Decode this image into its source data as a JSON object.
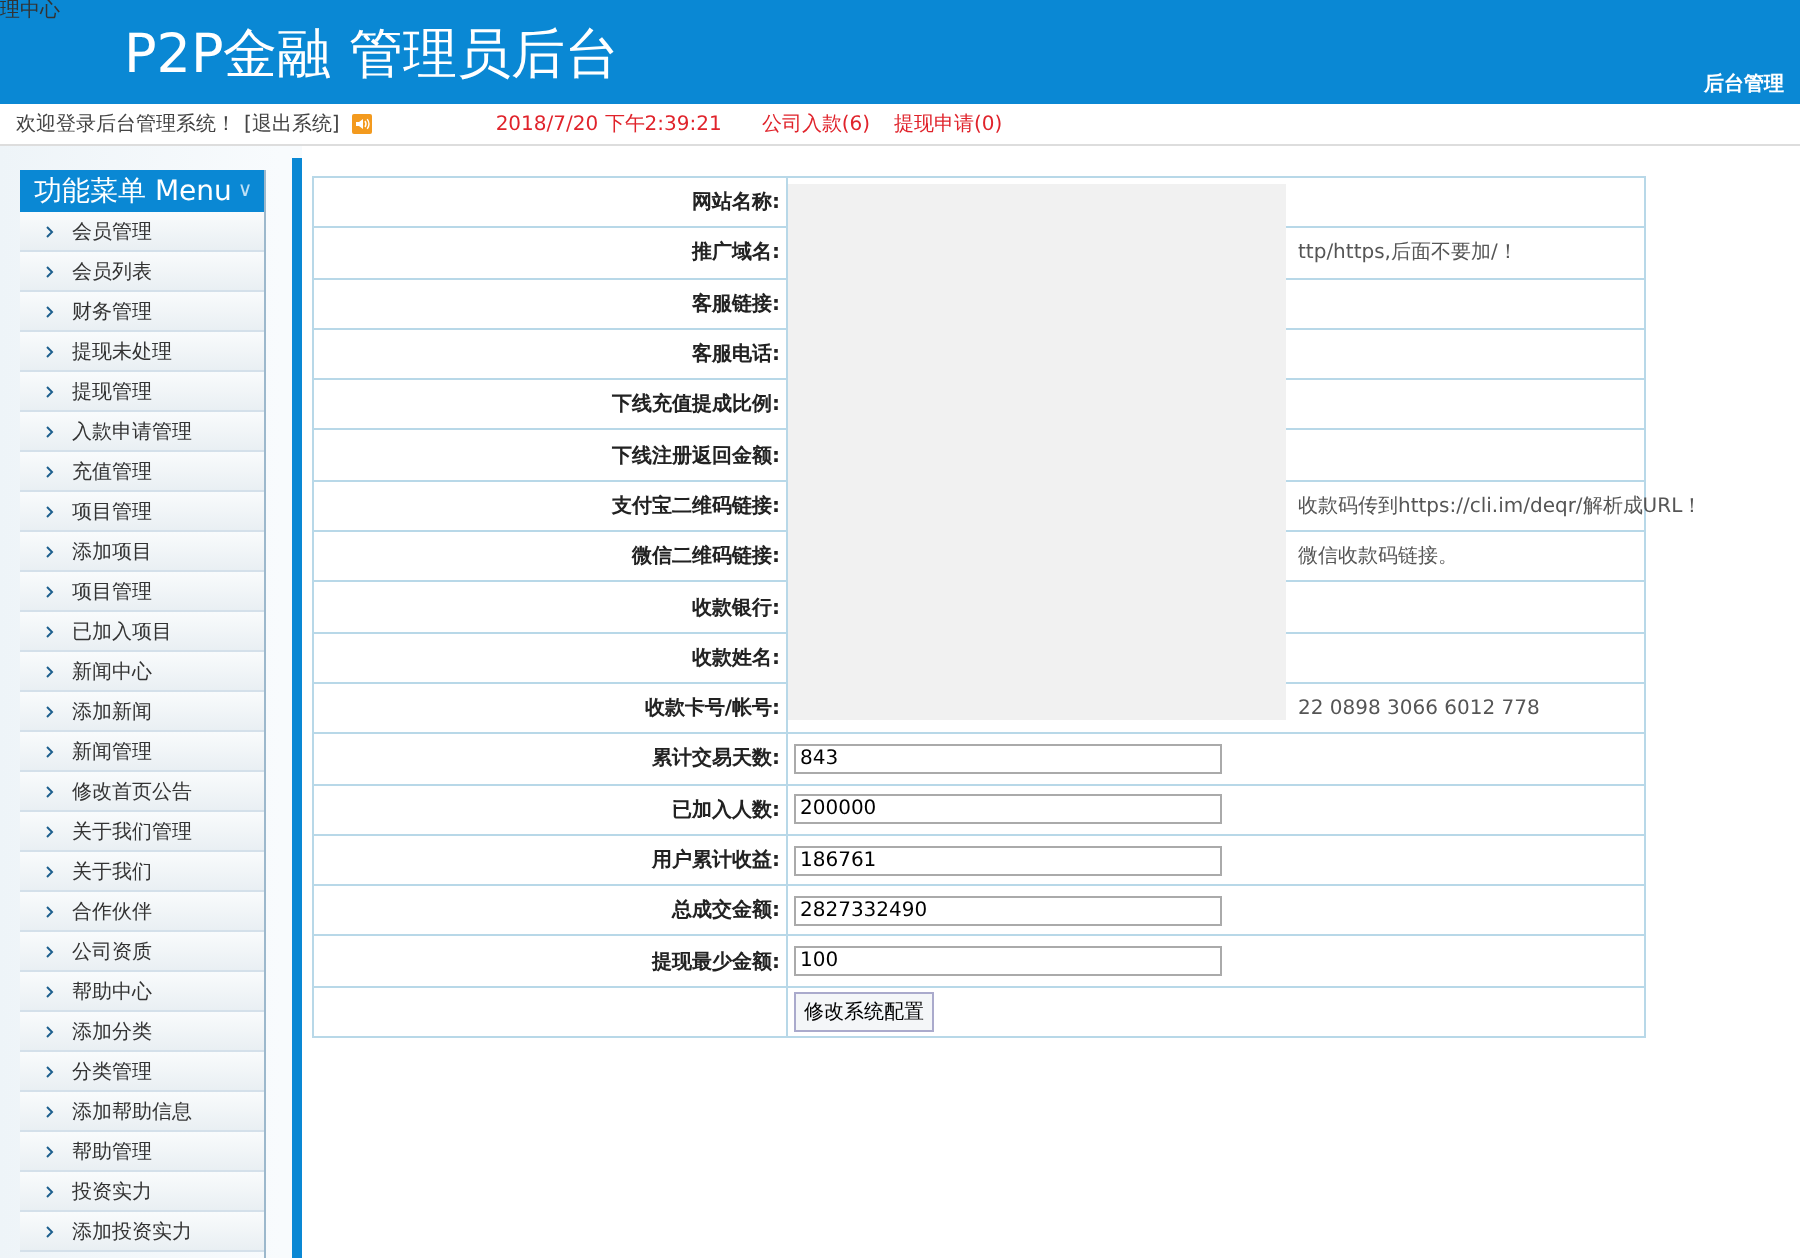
{
  "corner_text": "理中心",
  "header": {
    "title": "P2P金融 管理员后台",
    "right_link": "后台管理"
  },
  "status_bar": {
    "welcome": "欢迎登录后台管理系统！",
    "logout": "[退出系统]",
    "datetime": "2018/7/20 下午2:39:21",
    "deposits": "公司入款(6)",
    "withdrawals": "提现申请(0)"
  },
  "menu": {
    "title": "功能菜单 Menu",
    "caret": "∨",
    "items": [
      {
        "label": "会员管理"
      },
      {
        "label": "会员列表"
      },
      {
        "label": "财务管理"
      },
      {
        "label": "提现未处理"
      },
      {
        "label": "提现管理"
      },
      {
        "label": "入款申请管理"
      },
      {
        "label": "充值管理"
      },
      {
        "label": "项目管理"
      },
      {
        "label": "添加项目"
      },
      {
        "label": "项目管理"
      },
      {
        "label": "已加入项目"
      },
      {
        "label": "新闻中心"
      },
      {
        "label": "添加新闻"
      },
      {
        "label": "新闻管理"
      },
      {
        "label": "修改首页公告"
      },
      {
        "label": "关于我们管理"
      },
      {
        "label": "关于我们"
      },
      {
        "label": "合作伙伴"
      },
      {
        "label": "公司资质"
      },
      {
        "label": "帮助中心"
      },
      {
        "label": "添加分类"
      },
      {
        "label": "分类管理"
      },
      {
        "label": "添加帮助信息"
      },
      {
        "label": "帮助管理"
      },
      {
        "label": "投资实力"
      },
      {
        "label": "添加投资实力"
      }
    ]
  },
  "form": {
    "rows": [
      {
        "label": "网站名称:"
      },
      {
        "label": "推广域名:",
        "hint": "ttp/https,后面不要加/！"
      },
      {
        "label": "客服链接:"
      },
      {
        "label": "客服电话:"
      },
      {
        "label": "下线充值提成比例:"
      },
      {
        "label": "下线注册返回金额:"
      },
      {
        "label": "支付宝二维码链接:",
        "hint": "收款码传到https://cli.im/deqr/解析成URL！"
      },
      {
        "label": "微信二维码链接:",
        "hint": "微信收款码链接。"
      },
      {
        "label": "收款银行:"
      },
      {
        "label": "收款姓名:"
      },
      {
        "label": "收款卡号/帐号:",
        "hint": "22 0898 3066 6012 778"
      },
      {
        "label": "累计交易天数:",
        "value": "843"
      },
      {
        "label": "已加入人数:",
        "value": "200000"
      },
      {
        "label": "用户累计收益:",
        "value": "186761"
      },
      {
        "label": "总成交金额:",
        "value": "2827332490"
      },
      {
        "label": "提现最少金额:",
        "value": "100"
      }
    ],
    "submit": "修改系统配置"
  }
}
